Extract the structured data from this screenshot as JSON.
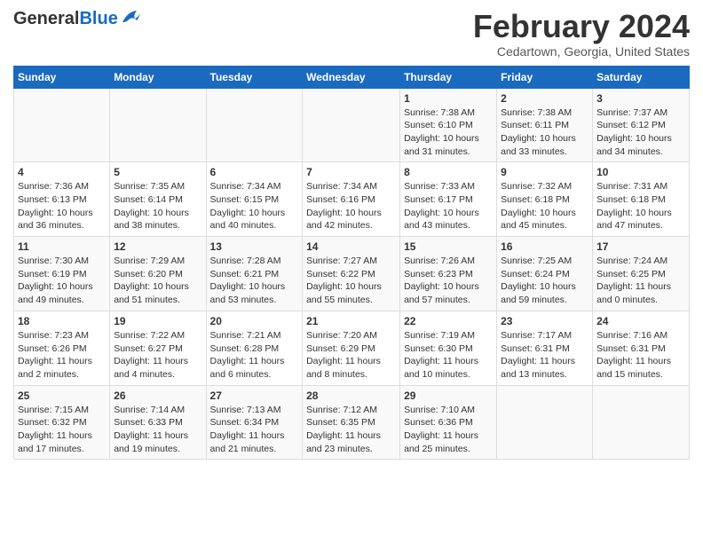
{
  "header": {
    "logo_general": "General",
    "logo_blue": "Blue",
    "main_title": "February 2024",
    "subtitle": "Cedartown, Georgia, United States"
  },
  "calendar": {
    "days_of_week": [
      "Sunday",
      "Monday",
      "Tuesday",
      "Wednesday",
      "Thursday",
      "Friday",
      "Saturday"
    ],
    "weeks": [
      [
        {
          "day": "",
          "info": ""
        },
        {
          "day": "",
          "info": ""
        },
        {
          "day": "",
          "info": ""
        },
        {
          "day": "",
          "info": ""
        },
        {
          "day": "1",
          "info": "Sunrise: 7:38 AM\nSunset: 6:10 PM\nDaylight: 10 hours\nand 31 minutes."
        },
        {
          "day": "2",
          "info": "Sunrise: 7:38 AM\nSunset: 6:11 PM\nDaylight: 10 hours\nand 33 minutes."
        },
        {
          "day": "3",
          "info": "Sunrise: 7:37 AM\nSunset: 6:12 PM\nDaylight: 10 hours\nand 34 minutes."
        }
      ],
      [
        {
          "day": "4",
          "info": "Sunrise: 7:36 AM\nSunset: 6:13 PM\nDaylight: 10 hours\nand 36 minutes."
        },
        {
          "day": "5",
          "info": "Sunrise: 7:35 AM\nSunset: 6:14 PM\nDaylight: 10 hours\nand 38 minutes."
        },
        {
          "day": "6",
          "info": "Sunrise: 7:34 AM\nSunset: 6:15 PM\nDaylight: 10 hours\nand 40 minutes."
        },
        {
          "day": "7",
          "info": "Sunrise: 7:34 AM\nSunset: 6:16 PM\nDaylight: 10 hours\nand 42 minutes."
        },
        {
          "day": "8",
          "info": "Sunrise: 7:33 AM\nSunset: 6:17 PM\nDaylight: 10 hours\nand 43 minutes."
        },
        {
          "day": "9",
          "info": "Sunrise: 7:32 AM\nSunset: 6:18 PM\nDaylight: 10 hours\nand 45 minutes."
        },
        {
          "day": "10",
          "info": "Sunrise: 7:31 AM\nSunset: 6:18 PM\nDaylight: 10 hours\nand 47 minutes."
        }
      ],
      [
        {
          "day": "11",
          "info": "Sunrise: 7:30 AM\nSunset: 6:19 PM\nDaylight: 10 hours\nand 49 minutes."
        },
        {
          "day": "12",
          "info": "Sunrise: 7:29 AM\nSunset: 6:20 PM\nDaylight: 10 hours\nand 51 minutes."
        },
        {
          "day": "13",
          "info": "Sunrise: 7:28 AM\nSunset: 6:21 PM\nDaylight: 10 hours\nand 53 minutes."
        },
        {
          "day": "14",
          "info": "Sunrise: 7:27 AM\nSunset: 6:22 PM\nDaylight: 10 hours\nand 55 minutes."
        },
        {
          "day": "15",
          "info": "Sunrise: 7:26 AM\nSunset: 6:23 PM\nDaylight: 10 hours\nand 57 minutes."
        },
        {
          "day": "16",
          "info": "Sunrise: 7:25 AM\nSunset: 6:24 PM\nDaylight: 10 hours\nand 59 minutes."
        },
        {
          "day": "17",
          "info": "Sunrise: 7:24 AM\nSunset: 6:25 PM\nDaylight: 11 hours\nand 0 minutes."
        }
      ],
      [
        {
          "day": "18",
          "info": "Sunrise: 7:23 AM\nSunset: 6:26 PM\nDaylight: 11 hours\nand 2 minutes."
        },
        {
          "day": "19",
          "info": "Sunrise: 7:22 AM\nSunset: 6:27 PM\nDaylight: 11 hours\nand 4 minutes."
        },
        {
          "day": "20",
          "info": "Sunrise: 7:21 AM\nSunset: 6:28 PM\nDaylight: 11 hours\nand 6 minutes."
        },
        {
          "day": "21",
          "info": "Sunrise: 7:20 AM\nSunset: 6:29 PM\nDaylight: 11 hours\nand 8 minutes."
        },
        {
          "day": "22",
          "info": "Sunrise: 7:19 AM\nSunset: 6:30 PM\nDaylight: 11 hours\nand 10 minutes."
        },
        {
          "day": "23",
          "info": "Sunrise: 7:17 AM\nSunset: 6:31 PM\nDaylight: 11 hours\nand 13 minutes."
        },
        {
          "day": "24",
          "info": "Sunrise: 7:16 AM\nSunset: 6:31 PM\nDaylight: 11 hours\nand 15 minutes."
        }
      ],
      [
        {
          "day": "25",
          "info": "Sunrise: 7:15 AM\nSunset: 6:32 PM\nDaylight: 11 hours\nand 17 minutes."
        },
        {
          "day": "26",
          "info": "Sunrise: 7:14 AM\nSunset: 6:33 PM\nDaylight: 11 hours\nand 19 minutes."
        },
        {
          "day": "27",
          "info": "Sunrise: 7:13 AM\nSunset: 6:34 PM\nDaylight: 11 hours\nand 21 minutes."
        },
        {
          "day": "28",
          "info": "Sunrise: 7:12 AM\nSunset: 6:35 PM\nDaylight: 11 hours\nand 23 minutes."
        },
        {
          "day": "29",
          "info": "Sunrise: 7:10 AM\nSunset: 6:36 PM\nDaylight: 11 hours\nand 25 minutes."
        },
        {
          "day": "",
          "info": ""
        },
        {
          "day": "",
          "info": ""
        }
      ]
    ]
  }
}
